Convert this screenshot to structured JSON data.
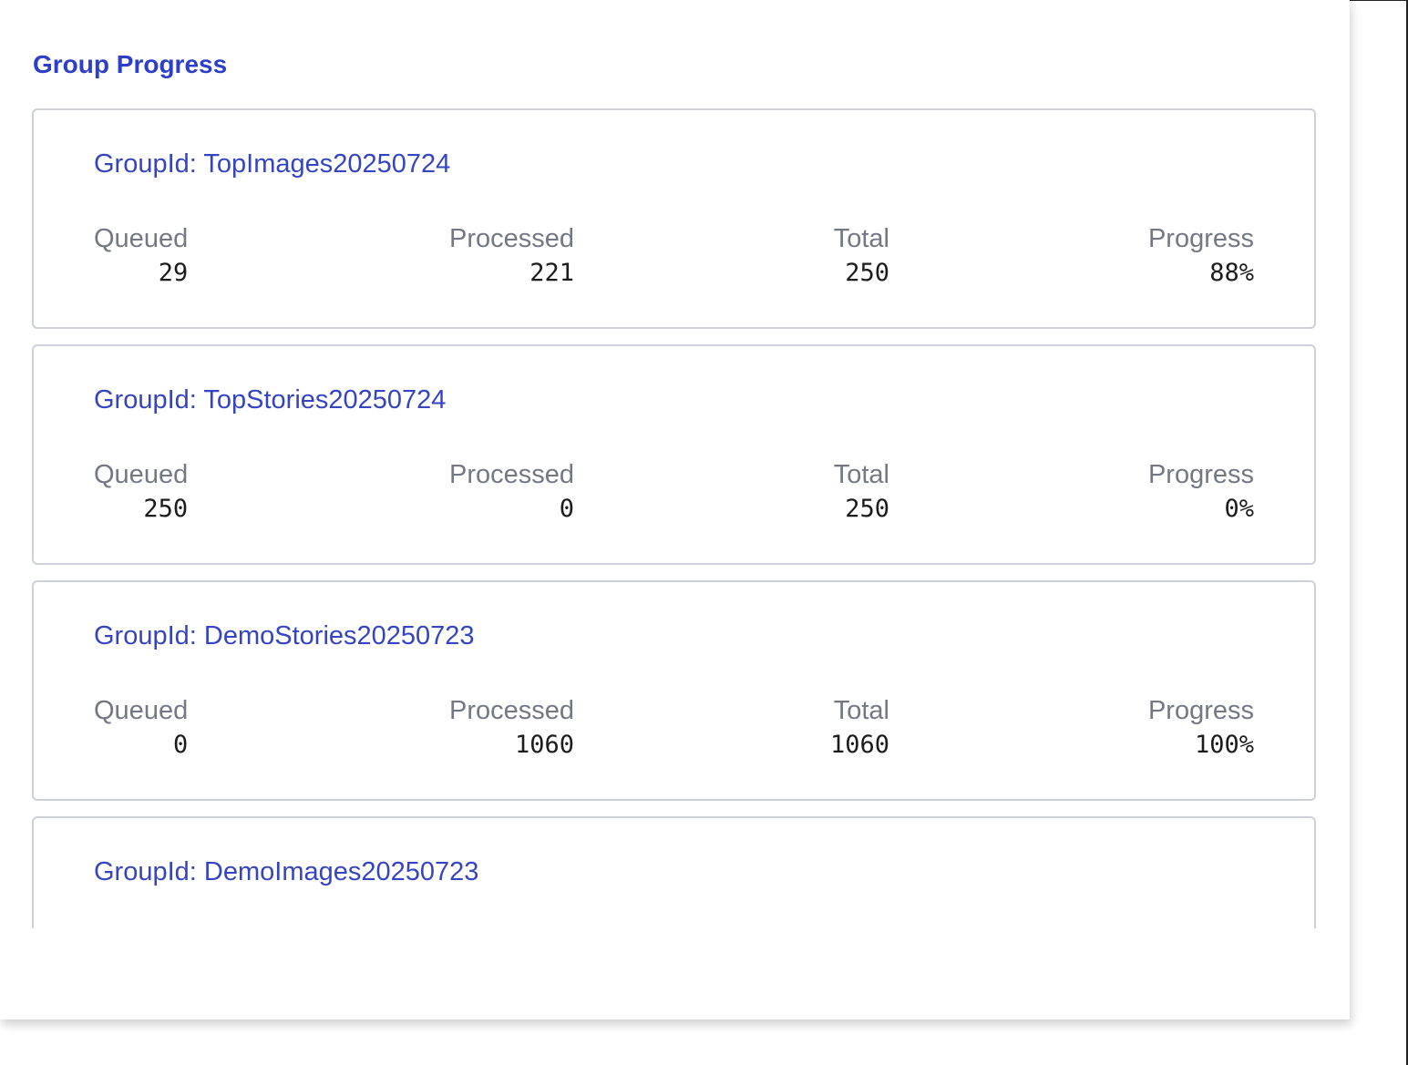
{
  "panel": {
    "title": "Group Progress"
  },
  "groups": [
    {
      "title": "GroupId: TopImages20250724",
      "queued_label": "Queued",
      "queued": "29",
      "processed_label": "Processed",
      "processed": "221",
      "total_label": "Total",
      "total": "250",
      "progress_label": "Progress",
      "progress": "88%"
    },
    {
      "title": "GroupId: TopStories20250724",
      "queued_label": "Queued",
      "queued": "250",
      "processed_label": "Processed",
      "processed": "0",
      "total_label": "Total",
      "total": "250",
      "progress_label": "Progress",
      "progress": "0%"
    },
    {
      "title": "GroupId: DemoStories20250723",
      "queued_label": "Queued",
      "queued": "0",
      "processed_label": "Processed",
      "processed": "1060",
      "total_label": "Total",
      "total": "1060",
      "progress_label": "Progress",
      "progress": "100%"
    },
    {
      "title": "GroupId: DemoImages20250723"
    }
  ],
  "colors": {
    "accent": "#2d3fc8",
    "group_title": "#3545c2",
    "label": "#737884",
    "value": "#1c1c1c",
    "card_border": "#cdd0d8"
  }
}
